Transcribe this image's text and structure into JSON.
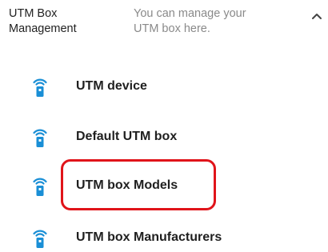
{
  "header": {
    "title": "UTM Box\nManagement",
    "description": "You can manage your\nUTM box here.",
    "collapse_icon": "chevron-up-icon"
  },
  "menu": {
    "icon": "utm-device-icon",
    "icon_color": "#1a8fd6",
    "items": [
      {
        "label": "UTM device"
      },
      {
        "label": "Default UTM box"
      },
      {
        "label": "UTM box Models",
        "highlighted": true
      },
      {
        "label": "UTM box Manufacturers"
      }
    ]
  },
  "highlight_color": "#e0141a"
}
